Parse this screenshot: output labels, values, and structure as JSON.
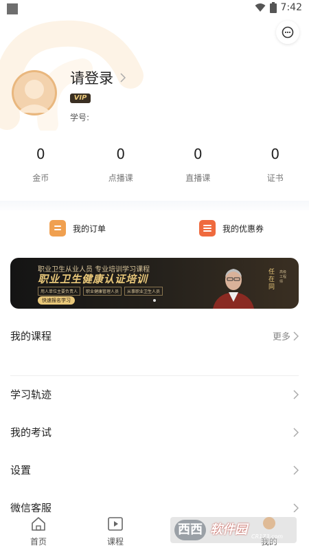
{
  "status_bar": {
    "time": "7:42"
  },
  "profile": {
    "login_text": "请登录",
    "vip_badge": "VIP",
    "student_id_label": "学号:"
  },
  "stats": [
    {
      "value": "0",
      "label": "金币"
    },
    {
      "value": "0",
      "label": "点播课"
    },
    {
      "value": "0",
      "label": "直播课"
    },
    {
      "value": "0",
      "label": "证书"
    }
  ],
  "quick_links": {
    "orders": "我的订单",
    "coupons": "我的优惠券"
  },
  "banner": {
    "top_line": "职业卫生从业人员 专业培训学习课程",
    "title": "职业卫生健康认证培训",
    "tags": [
      "用人单位主要负责人",
      "职业健康管理人员",
      "从事职业卫生人员"
    ],
    "cta": "快速报名学习",
    "person_name": "任在同",
    "person_desc": "高级工程师"
  },
  "menu": {
    "my_courses": "我的课程",
    "more": "更多",
    "study_track": "学习轨迹",
    "my_exams": "我的考试",
    "settings": "设置",
    "wechat_service": "微信客服"
  },
  "tabbar": {
    "home": "首页",
    "courses": "课程",
    "mine": "我的"
  },
  "watermark": {
    "logo": "西西",
    "text": "软件园",
    "url": "CR173.com"
  },
  "colors": {
    "accent_orange": "#f0a050",
    "coupon_red": "#ef6a3e",
    "banner_gold": "#e9c87a",
    "avatar": "#e9b77e"
  }
}
